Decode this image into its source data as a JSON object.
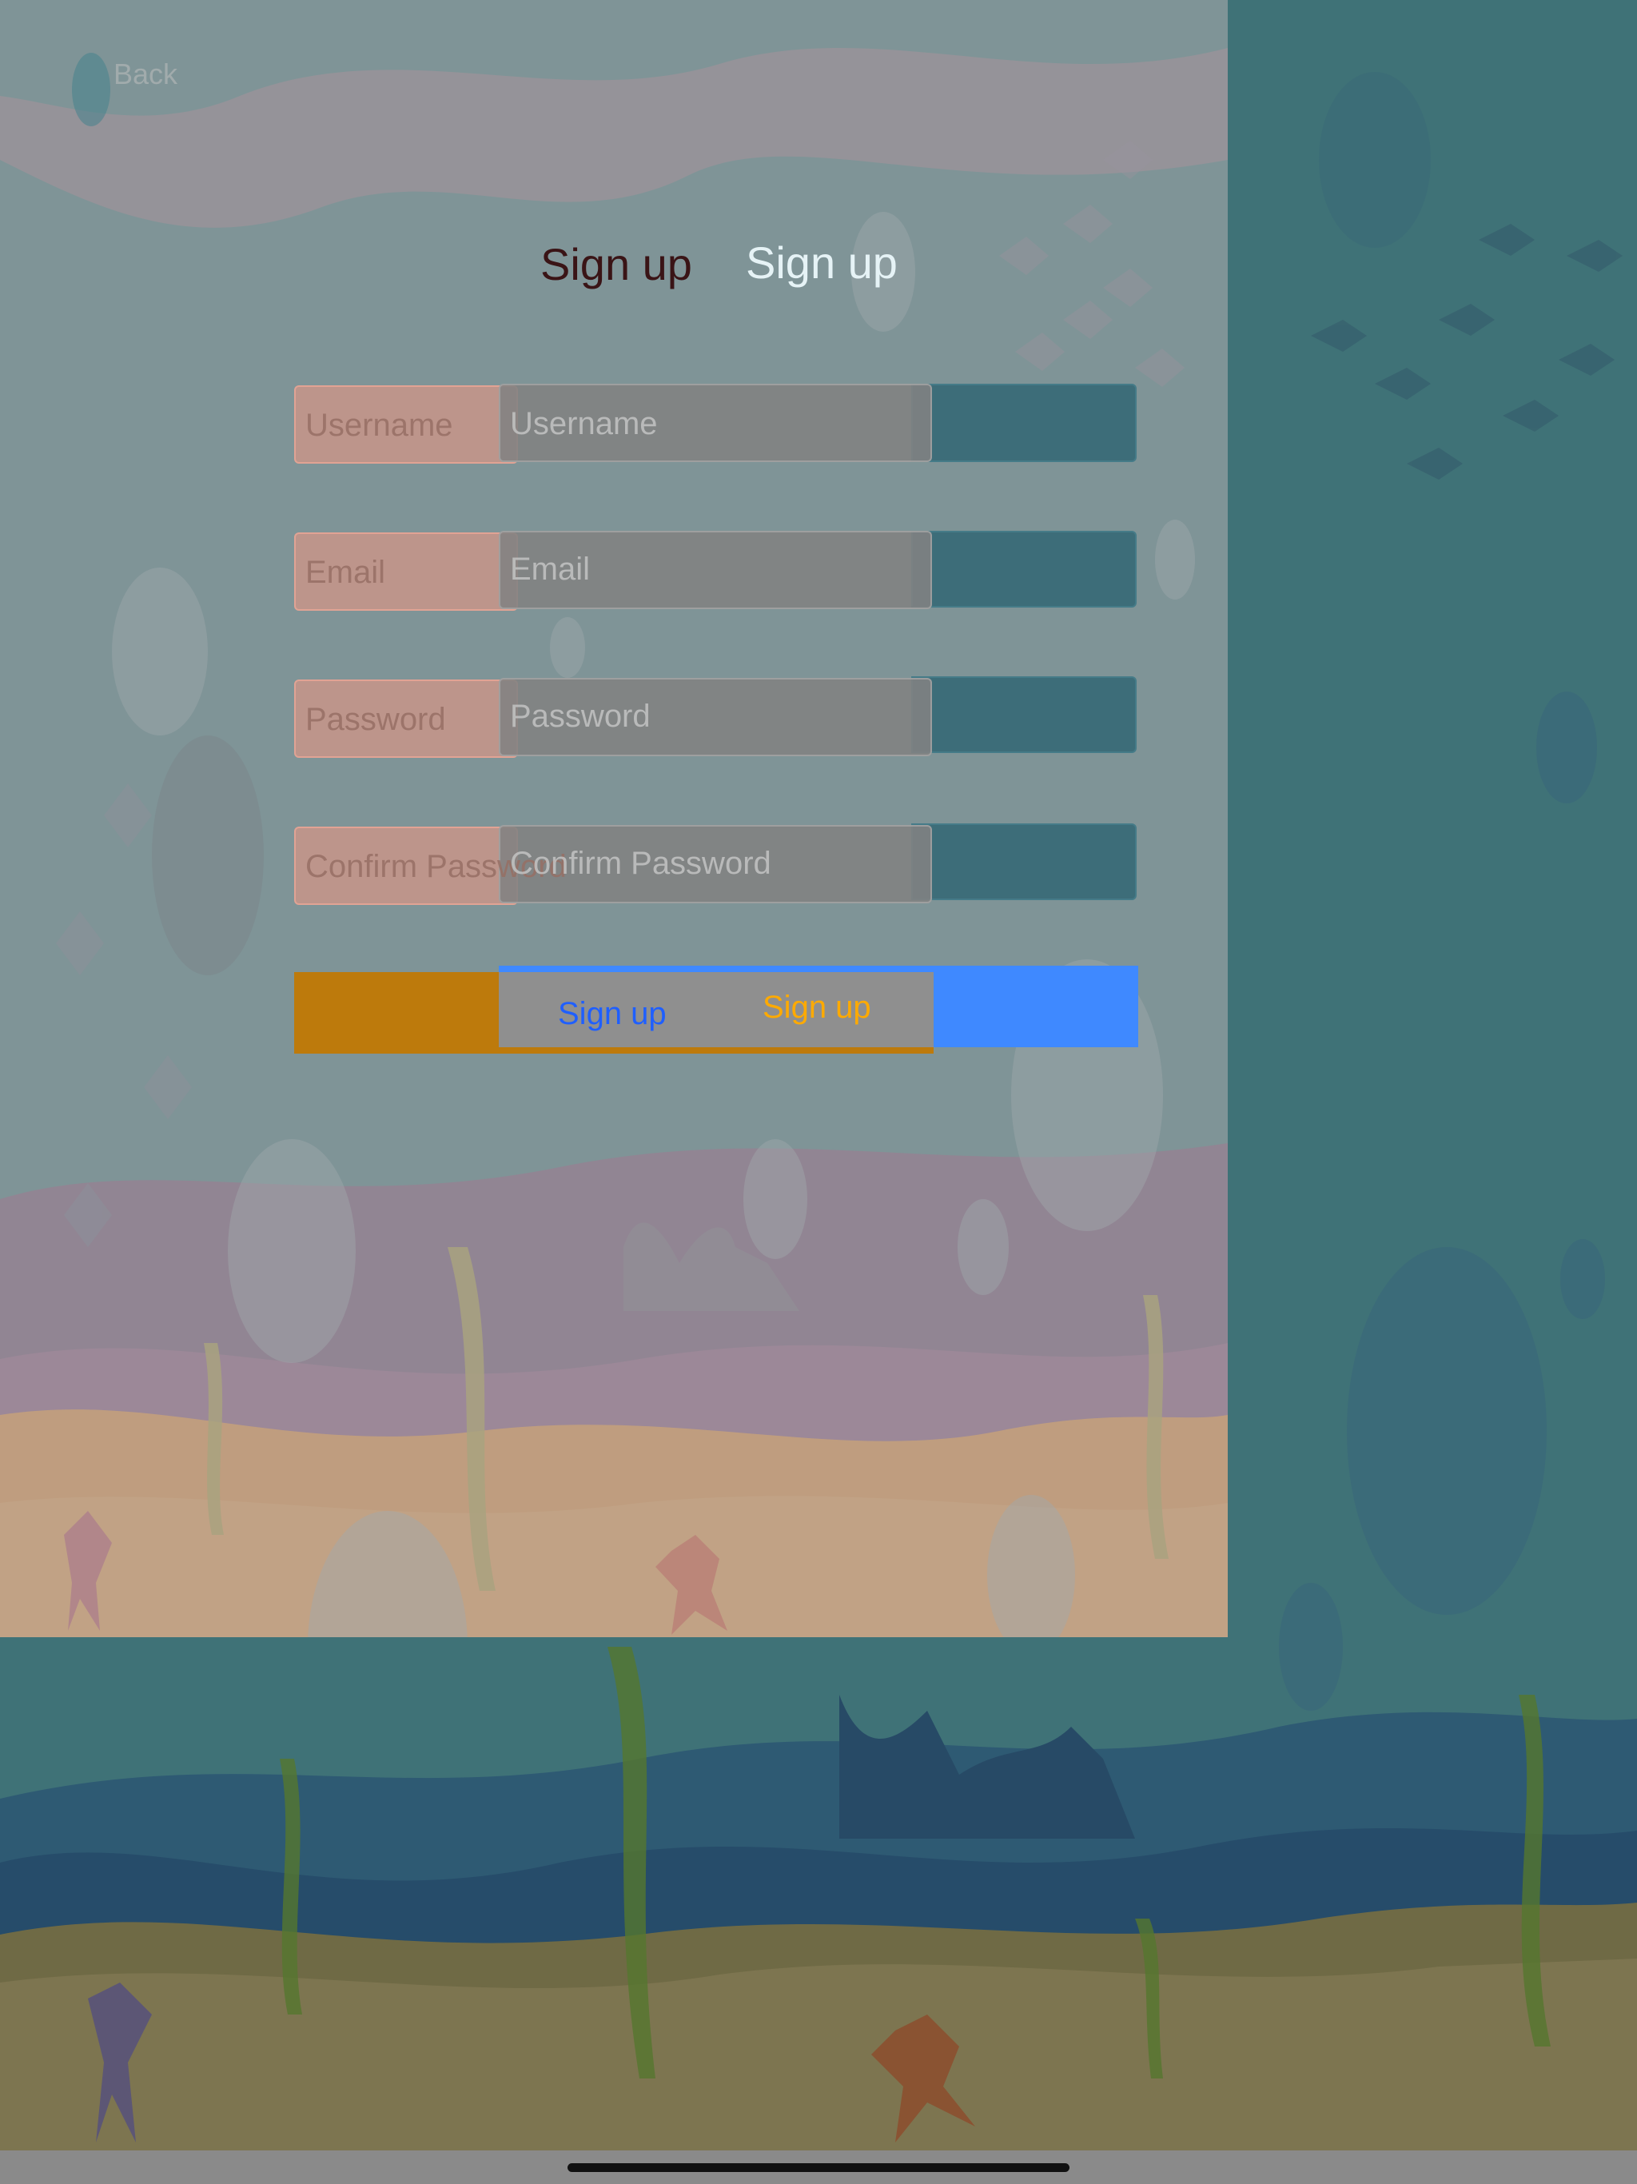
{
  "nav": {
    "back_label": "Back"
  },
  "title": {
    "left": "Sign up",
    "right": "Sign up"
  },
  "fields": [
    {
      "name": "username",
      "label": "Username",
      "placeholder": "Username"
    },
    {
      "name": "email",
      "label": "Email",
      "placeholder": "Email"
    },
    {
      "name": "password",
      "label": "Password",
      "placeholder": "Password"
    },
    {
      "name": "confirm-password",
      "label": "Confirm Password",
      "placeholder": "Confirm Password"
    }
  ],
  "signup_button": {
    "label_blue": "Sign up",
    "label_orange": "Sign up"
  },
  "colors": {
    "orange_button": "#bd7a0c",
    "blue_button": "#3f89ff",
    "blue_label": "#1f5fff",
    "orange_label": "#ffaa00"
  },
  "icons": [
    "chevron-left-icon"
  ]
}
